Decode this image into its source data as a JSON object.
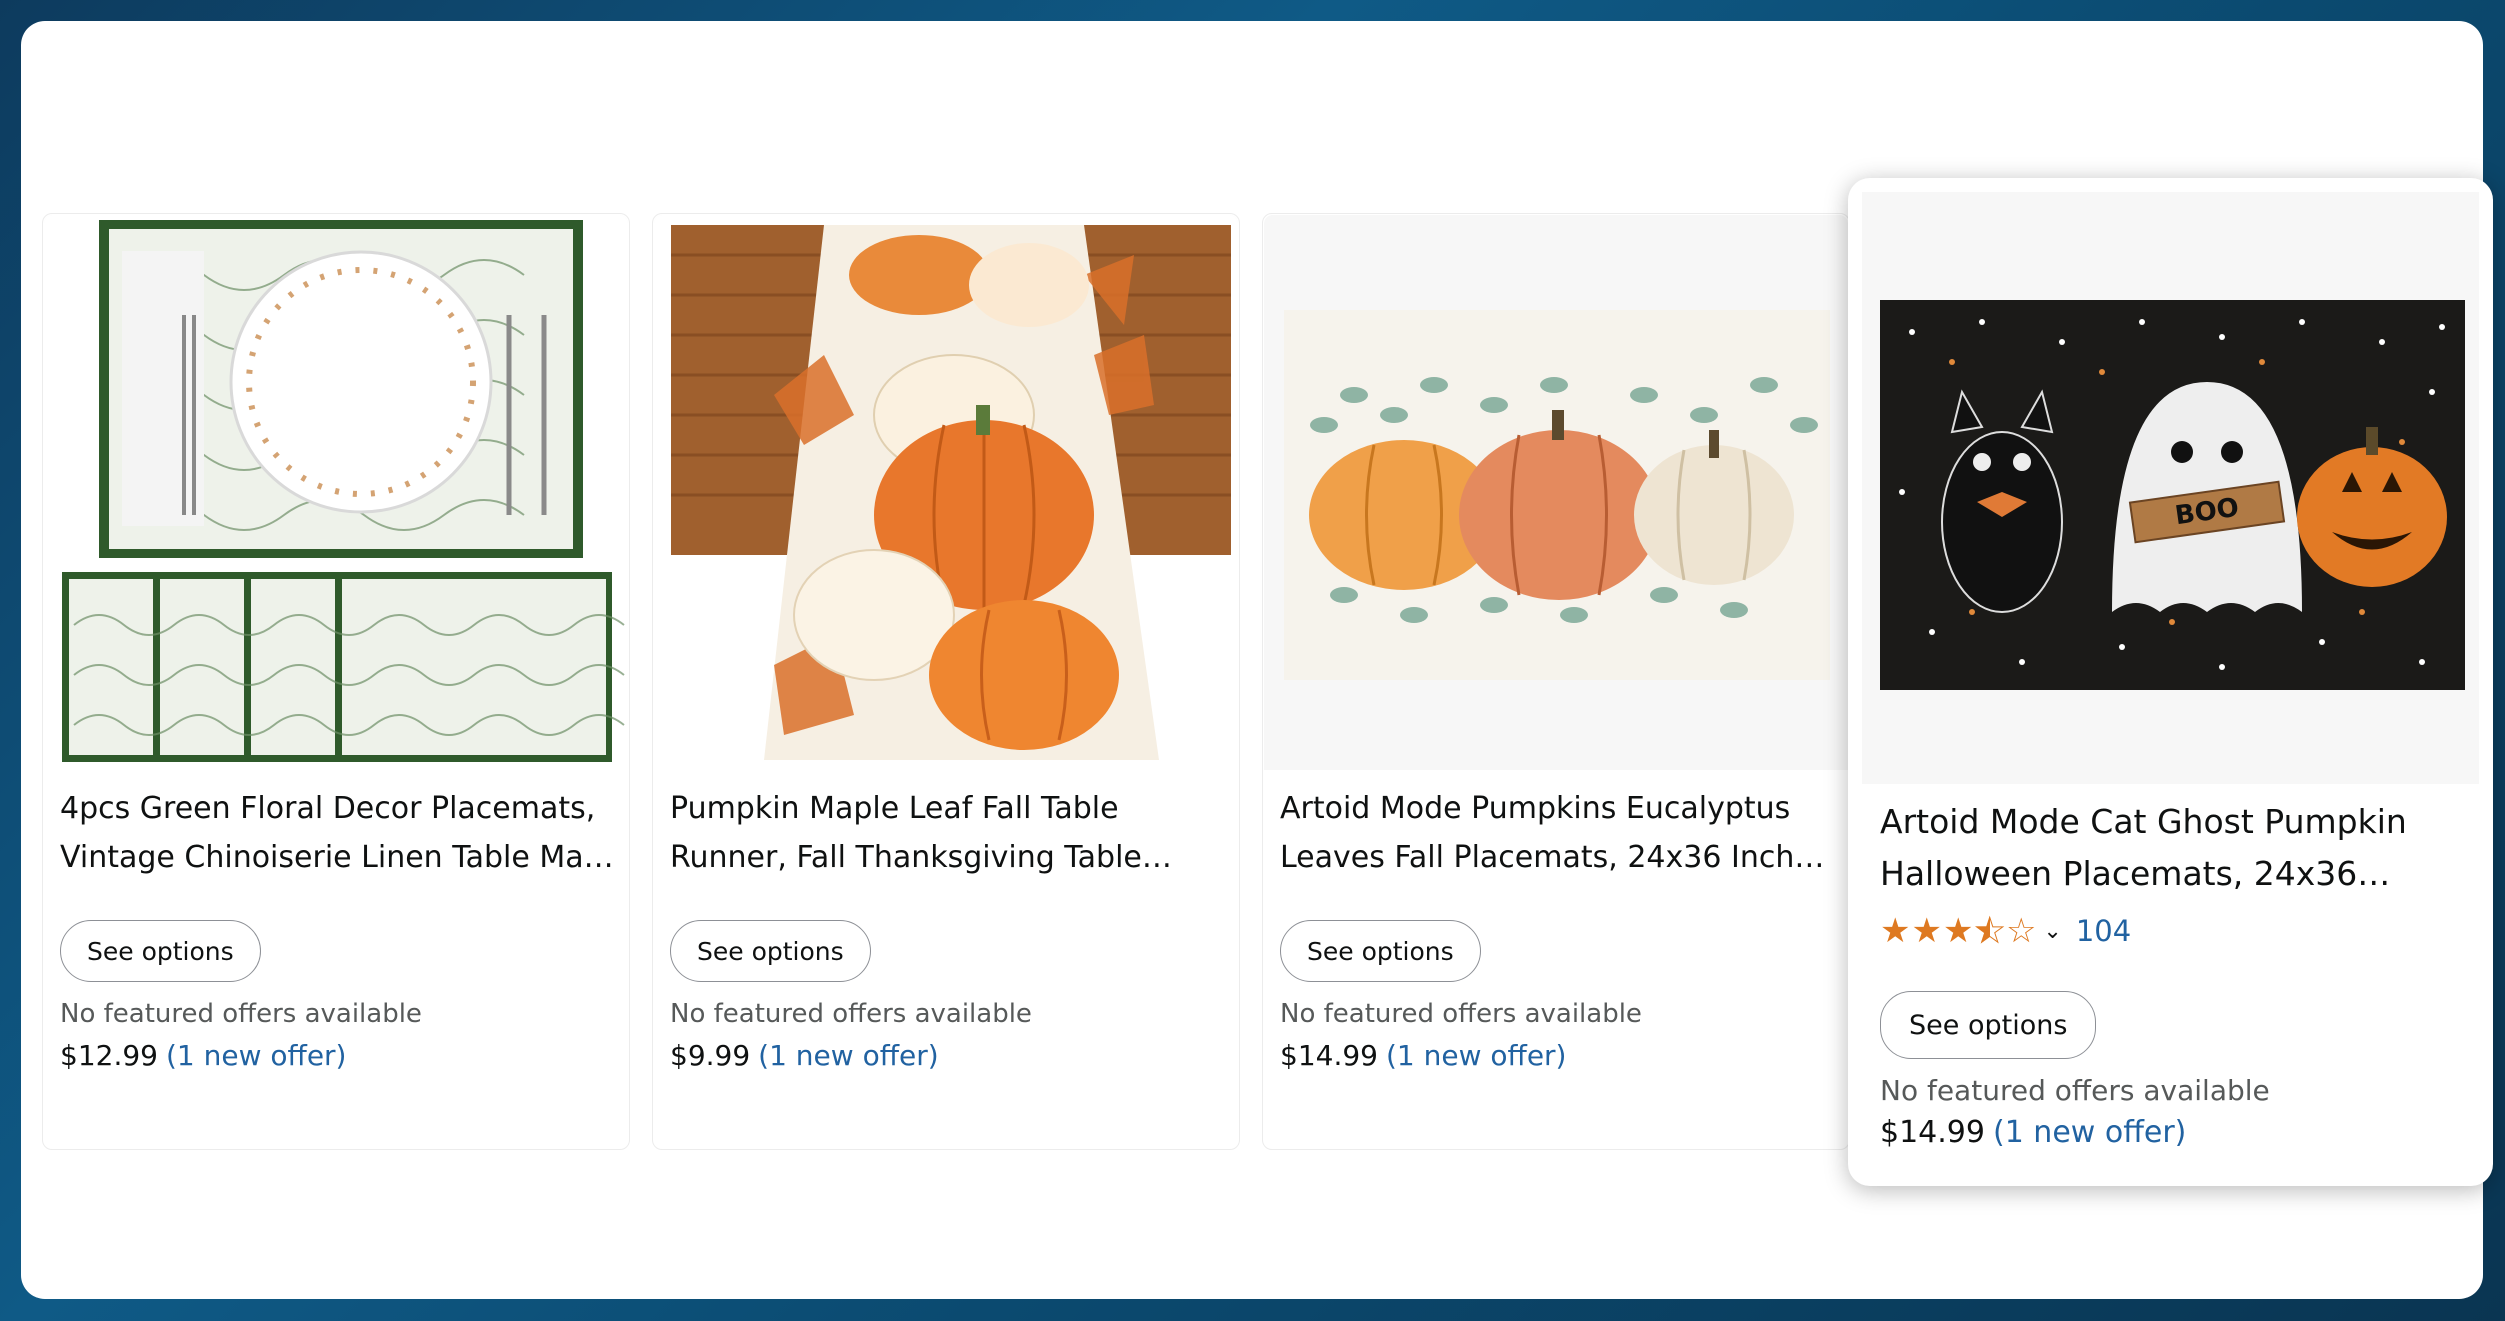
{
  "products": [
    {
      "title": "4pcs Green Floral Decor Placemats, Vintage Chinoiserie Linen Table Ma…",
      "button": "See options",
      "no_offers": "No featured offers available",
      "price": "$12.99",
      "offer": "(1 new offer)"
    },
    {
      "title": "Pumpkin Maple Leaf Fall Table Runner, Fall Thanksgiving Table…",
      "button": "See options",
      "no_offers": "No featured offers available",
      "price": "$9.99",
      "offer": "(1 new offer)"
    },
    {
      "title": "Artoid Mode Pumpkins Eucalyptus Leaves Fall Placemats, 24x36 Inch…",
      "button": "See options",
      "no_offers": "No featured offers available",
      "price": "$14.99",
      "offer": "(1 new offer)"
    },
    {
      "title": "Artoid Mode Cat Ghost Pumpkin Halloween Placemats, 24x36 Inch…",
      "rating": 3.5,
      "review_count": "104",
      "button": "See options",
      "no_offers": "No featured offers available",
      "price": "$14.99",
      "offer": "(1 new offer)"
    }
  ],
  "colors": {
    "star": "#de7921",
    "link": "#2162a1",
    "text": "#0f1111",
    "muted": "#565959"
  }
}
